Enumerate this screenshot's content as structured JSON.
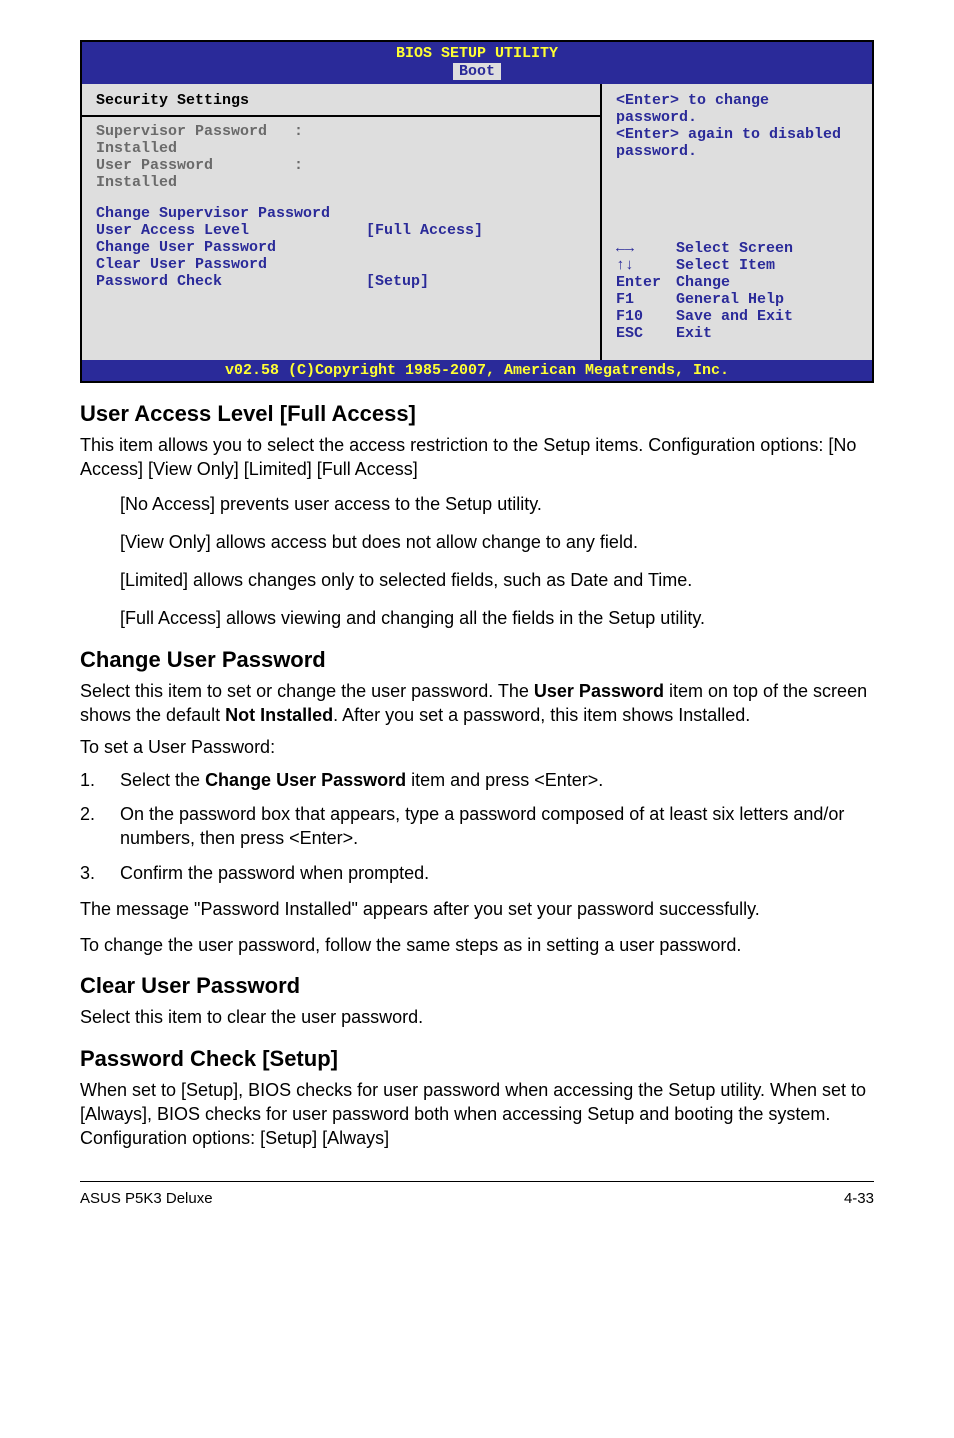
{
  "bios": {
    "title": "BIOS SETUP UTILITY",
    "tab": "Boot",
    "footer": "v02.58 (C)Copyright 1985-2007, American Megatrends, Inc.",
    "left": {
      "section_title": "Security Settings",
      "sup_pw_label": "Supervisor Password",
      "sup_pw_sep": ":",
      "sup_pw_val": "Installed",
      "user_pw_label": "User Password",
      "user_pw_sep": ":",
      "user_pw_val": "Installed",
      "change_sup": "Change Supervisor Password",
      "ual_label": "User Access Level",
      "ual_val": "[Full Access]",
      "change_user": "Change User Password",
      "clear_user": "Clear User Password",
      "pw_check_label": "Password Check",
      "pw_check_val": "[Setup]"
    },
    "right": {
      "help1": "<Enter> to change password.",
      "help2": "<Enter> again to disabled password.",
      "nav": {
        "arrows_lr": "←→",
        "arrows_lr_txt": "Select Screen",
        "arrows_ud": "↑↓",
        "arrows_ud_txt": "Select Item",
        "enter_key": "Enter",
        "enter_txt": "Change",
        "f1_key": "F1",
        "f1_txt": "General Help",
        "f10_key": "F10",
        "f10_txt": "Save and Exit",
        "esc_key": "ESC",
        "esc_txt": "Exit"
      }
    }
  },
  "doc": {
    "h_ual": "User Access Level [Full Access]",
    "p_ual_1": "This item allows you to select the access restriction to the Setup items. Configuration options: [No Access] [View Only] [Limited] [Full Access]",
    "p_noaccess": "[No Access] prevents user access to the Setup utility.",
    "p_viewonly": "[View Only] allows access but does not allow change to any field.",
    "p_limited": "[Limited] allows changes only to selected fields, such as Date and Time.",
    "p_fullaccess": "[Full Access] allows viewing and changing all the fields in the Setup utility.",
    "h_cup": "Change User Password",
    "p_cup_1a": "Select this item to set or change the user password. The ",
    "p_cup_1b": "User Password",
    "p_cup_1c": " item on top of the screen shows the default ",
    "p_cup_1d": "Not Installed",
    "p_cup_1e": ". After you set a password, this item shows Installed.",
    "p_cup_2": "To set a User Password:",
    "step1a": "Select the ",
    "step1b": "Change User Password",
    "step1c": " item and press <Enter>.",
    "step2": "On the password box that appears, type a password composed of at least six letters and/or numbers, then press <Enter>.",
    "step3": "Confirm the password when prompted.",
    "p_cup_3": "The message \"Password Installed\" appears after you set your password successfully.",
    "p_cup_4": "To change the user password, follow the same steps as in setting a user password.",
    "h_clearup": "Clear User Password",
    "p_clearup": "Select this item to clear the user password.",
    "h_pwcheck": "Password Check [Setup]",
    "p_pwcheck": "When set to [Setup], BIOS checks for user password when accessing the Setup utility. When set to [Always], BIOS checks for user password both when accessing Setup and booting the system. Configuration options: [Setup] [Always]"
  },
  "footer": {
    "product": "ASUS P5K3 Deluxe",
    "pagenum": "4-33"
  }
}
